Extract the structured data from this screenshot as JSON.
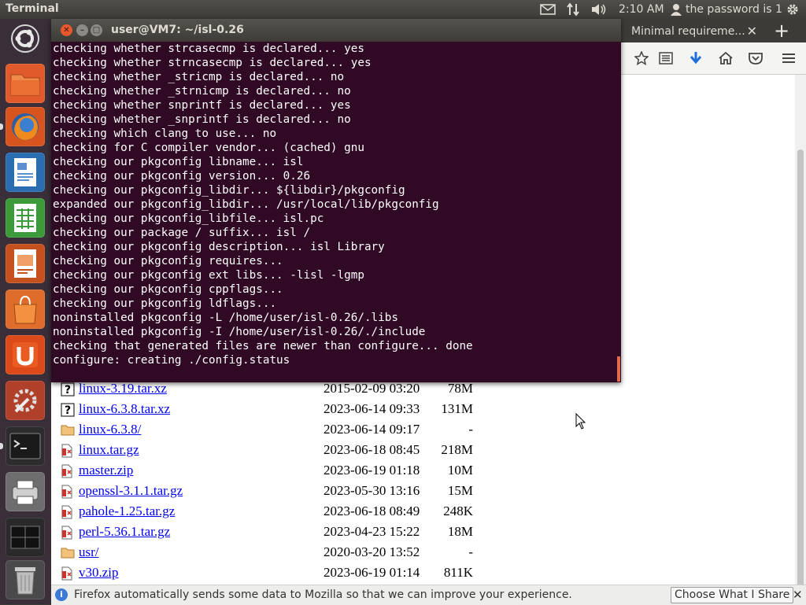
{
  "top_panel": {
    "app_title": "Terminal",
    "time": "2:10 AM",
    "user": "the password is 1"
  },
  "launcher": {
    "items": [
      "Dash Home",
      "Files",
      "Firefox Web Browser",
      "LibreOffice Writer",
      "LibreOffice Calc",
      "LibreOffice Impress",
      "Ubuntu Software Center",
      "Ubuntu One",
      "System Settings",
      "Terminal",
      "Printers",
      "Workspace Switcher",
      "Trash"
    ]
  },
  "terminal": {
    "title": "user@VM7: ~/isl-0.26",
    "lines": [
      "checking whether strcasecmp is declared... yes",
      "checking whether strncasecmp is declared... yes",
      "checking whether _stricmp is declared... no",
      "checking whether _strnicmp is declared... no",
      "checking whether snprintf is declared... yes",
      "checking whether _snprintf is declared... no",
      "checking which clang to use... no",
      "checking for C compiler vendor... (cached) gnu",
      "checking our pkgconfig libname... isl",
      "checking our pkgconfig version... 0.26",
      "checking our pkgconfig_libdir... ${libdir}/pkgconfig",
      "expanded our pkgconfig_libdir... /usr/local/lib/pkgconfig",
      "checking our pkgconfig_libfile... isl.pc",
      "checking our package / suffix... isl /",
      "checking our pkgconfig description... isl Library",
      "checking our pkgconfig requires...",
      "checking our pkgconfig ext libs... -lisl -lgmp",
      "checking our pkgconfig cppflags...",
      "checking our pkgconfig ldflags...",
      "noninstalled pkgconfig -L /home/user/isl-0.26/.libs",
      "noninstalled pkgconfig -I /home/user/isl-0.26/./include",
      "checking that generated files are newer than configure... done",
      "configure: creating ./config.status"
    ]
  },
  "firefox": {
    "tab_title": "Minimal requireme...",
    "notification": "Firefox automatically sends some data to Mozilla so that we can improve your experience.",
    "notification_button": "Choose What I Share",
    "files": [
      {
        "name": "linux-3.19.tar.xz",
        "date": "2015-02-09 03:20",
        "size": "78M",
        "type": "unknown"
      },
      {
        "name": "linux-6.3.8.tar.xz",
        "date": "2023-06-14 09:33",
        "size": "131M",
        "type": "unknown"
      },
      {
        "name": "linux-6.3.8/",
        "date": "2023-06-14 09:17",
        "size": "-",
        "type": "folder"
      },
      {
        "name": "linux.tar.gz",
        "date": "2023-06-18 08:45",
        "size": "218M",
        "type": "archive"
      },
      {
        "name": "master.zip",
        "date": "2023-06-19 01:18",
        "size": "10M",
        "type": "archive"
      },
      {
        "name": "openssl-3.1.1.tar.gz",
        "date": "2023-05-30 13:16",
        "size": "15M",
        "type": "archive"
      },
      {
        "name": "pahole-1.25.tar.gz",
        "date": "2023-06-18 08:49",
        "size": "248K",
        "type": "archive"
      },
      {
        "name": "perl-5.36.1.tar.gz",
        "date": "2023-04-23 15:22",
        "size": "18M",
        "type": "archive"
      },
      {
        "name": "usr/",
        "date": "2020-03-20 13:52",
        "size": "-",
        "type": "folder"
      },
      {
        "name": "v30.zip",
        "date": "2023-06-19 01:14",
        "size": "811K",
        "type": "archive"
      }
    ]
  }
}
